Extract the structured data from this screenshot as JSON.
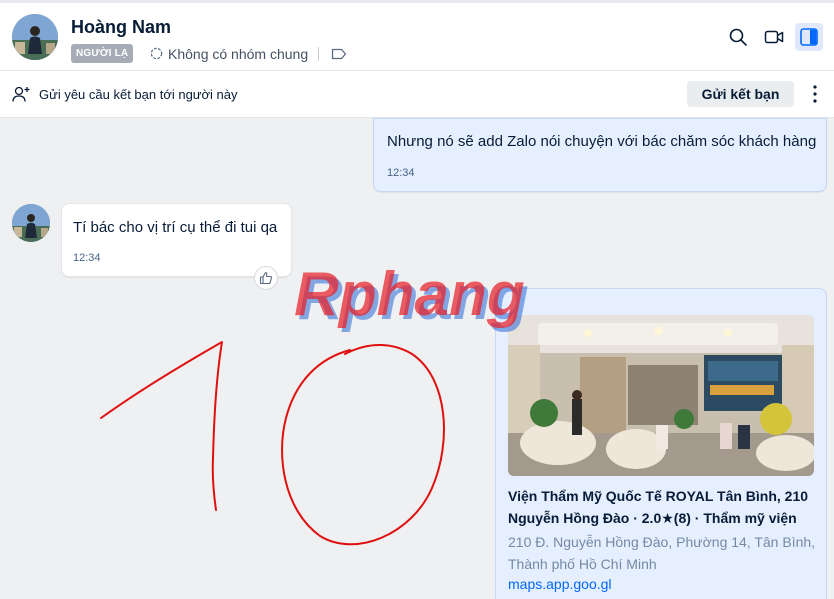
{
  "header": {
    "contact_name": "Hoàng Nam",
    "stranger_badge": "NGƯỜI LẠ",
    "common_groups": "Không có nhóm chung"
  },
  "friend_request_bar": {
    "text": "Gửi yêu cầu kết bạn tới người này",
    "button_label": "Gửi kết bạn"
  },
  "messages": [
    {
      "sender": "me",
      "text": "Nhưng nó sẽ add Zalo nói chuyện với bác chăm sóc khách hàng",
      "time": "12:34"
    },
    {
      "sender": "Hoàng Nam",
      "text": "Tí bác cho vị trí cụ thể đi tui qa",
      "time": "12:34"
    }
  ],
  "link_card": {
    "title": "Viện Thẩm Mỹ Quốc Tế ROYAL Tân Bình, 210 Nguyễn Hồng Đào · 2.0★(8) · Thẩm mỹ viện",
    "address": "210 Đ. Nguyễn Hồng Đào, Phường 14, Tân Bình, Thành phố Hồ Chí Minh",
    "domain": "maps.app.goo.gl"
  },
  "watermark_text": "Rphang",
  "annotation_text": "10",
  "icons": {
    "search": "search-icon",
    "video": "video-call-icon",
    "panel": "conversation-info-icon",
    "add_friend": "add-user-icon",
    "more": "more-vertical-icon",
    "like": "thumbs-up-icon",
    "groups": "group-circle-icon",
    "tag": "tag-icon"
  },
  "colors": {
    "accent": "#0068ff",
    "sent_bubble": "#e5efff",
    "received_bubble": "#ffffff",
    "annotation_red": "#e01010",
    "watermark_red": "#e8222a",
    "watermark_blue": "#2b6bd6"
  }
}
